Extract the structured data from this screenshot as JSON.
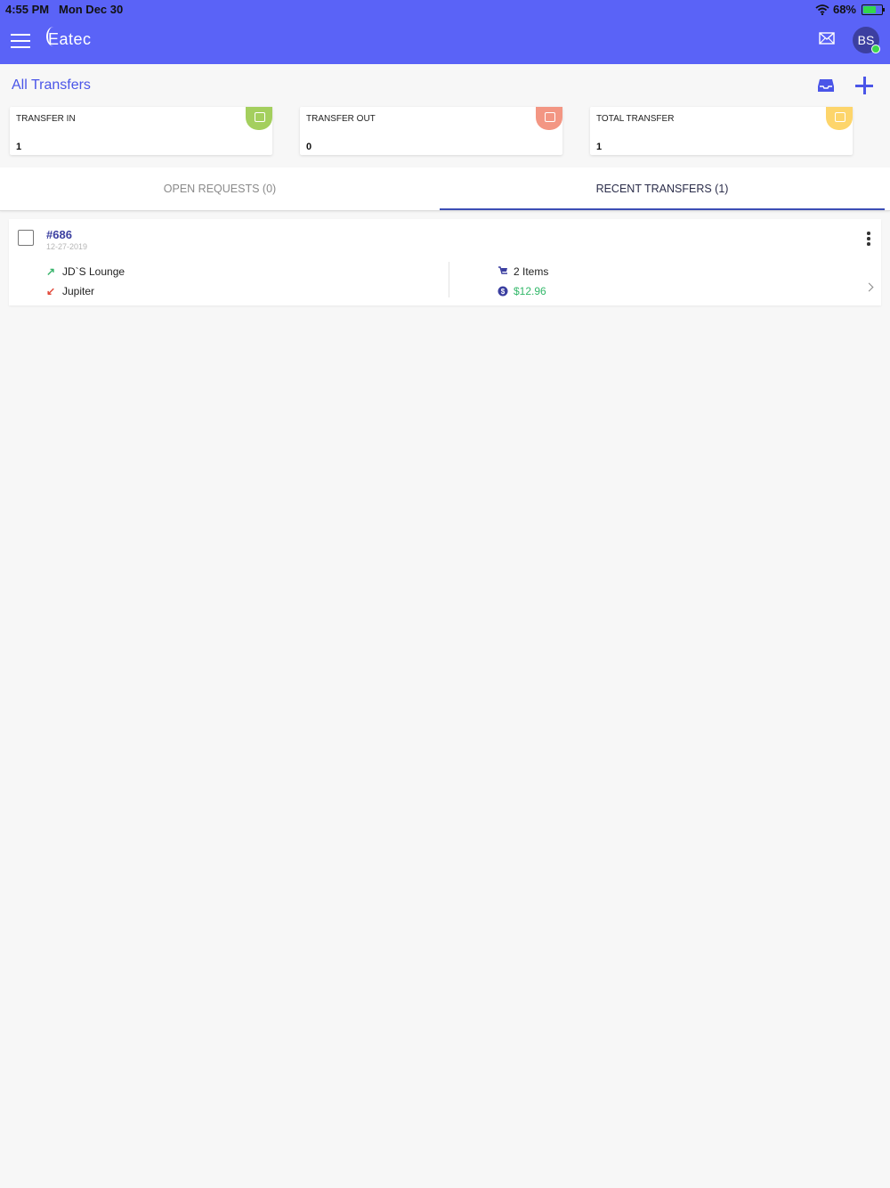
{
  "status": {
    "time": "4:55 PM",
    "date": "Mon Dec 30",
    "battery": "68%",
    "battery_level": 0.68
  },
  "app": {
    "logo": "Eatec",
    "avatar_initials": "BS"
  },
  "header": {
    "title": "All Transfers"
  },
  "stats": [
    {
      "label": "TRANSFER IN",
      "value": "1",
      "color": "#a4cf5e"
    },
    {
      "label": "TRANSFER OUT",
      "value": "0",
      "color": "#f39683"
    },
    {
      "label": "TOTAL TRANSFER",
      "value": "1",
      "color": "#fdd56b"
    }
  ],
  "tabs": {
    "open_requests": "OPEN REQUESTS (0)",
    "recent_transfers": "RECENT TRANSFERS (1)"
  },
  "transfer": {
    "id": "#686",
    "date": "12-27-2019",
    "from": "JD`S Lounge",
    "to": "Jupiter",
    "items": "2 Items",
    "amount": "$12.96",
    "from_color": "#3cb56e",
    "to_color": "#e24a3b",
    "amount_color": "#33b86a"
  }
}
